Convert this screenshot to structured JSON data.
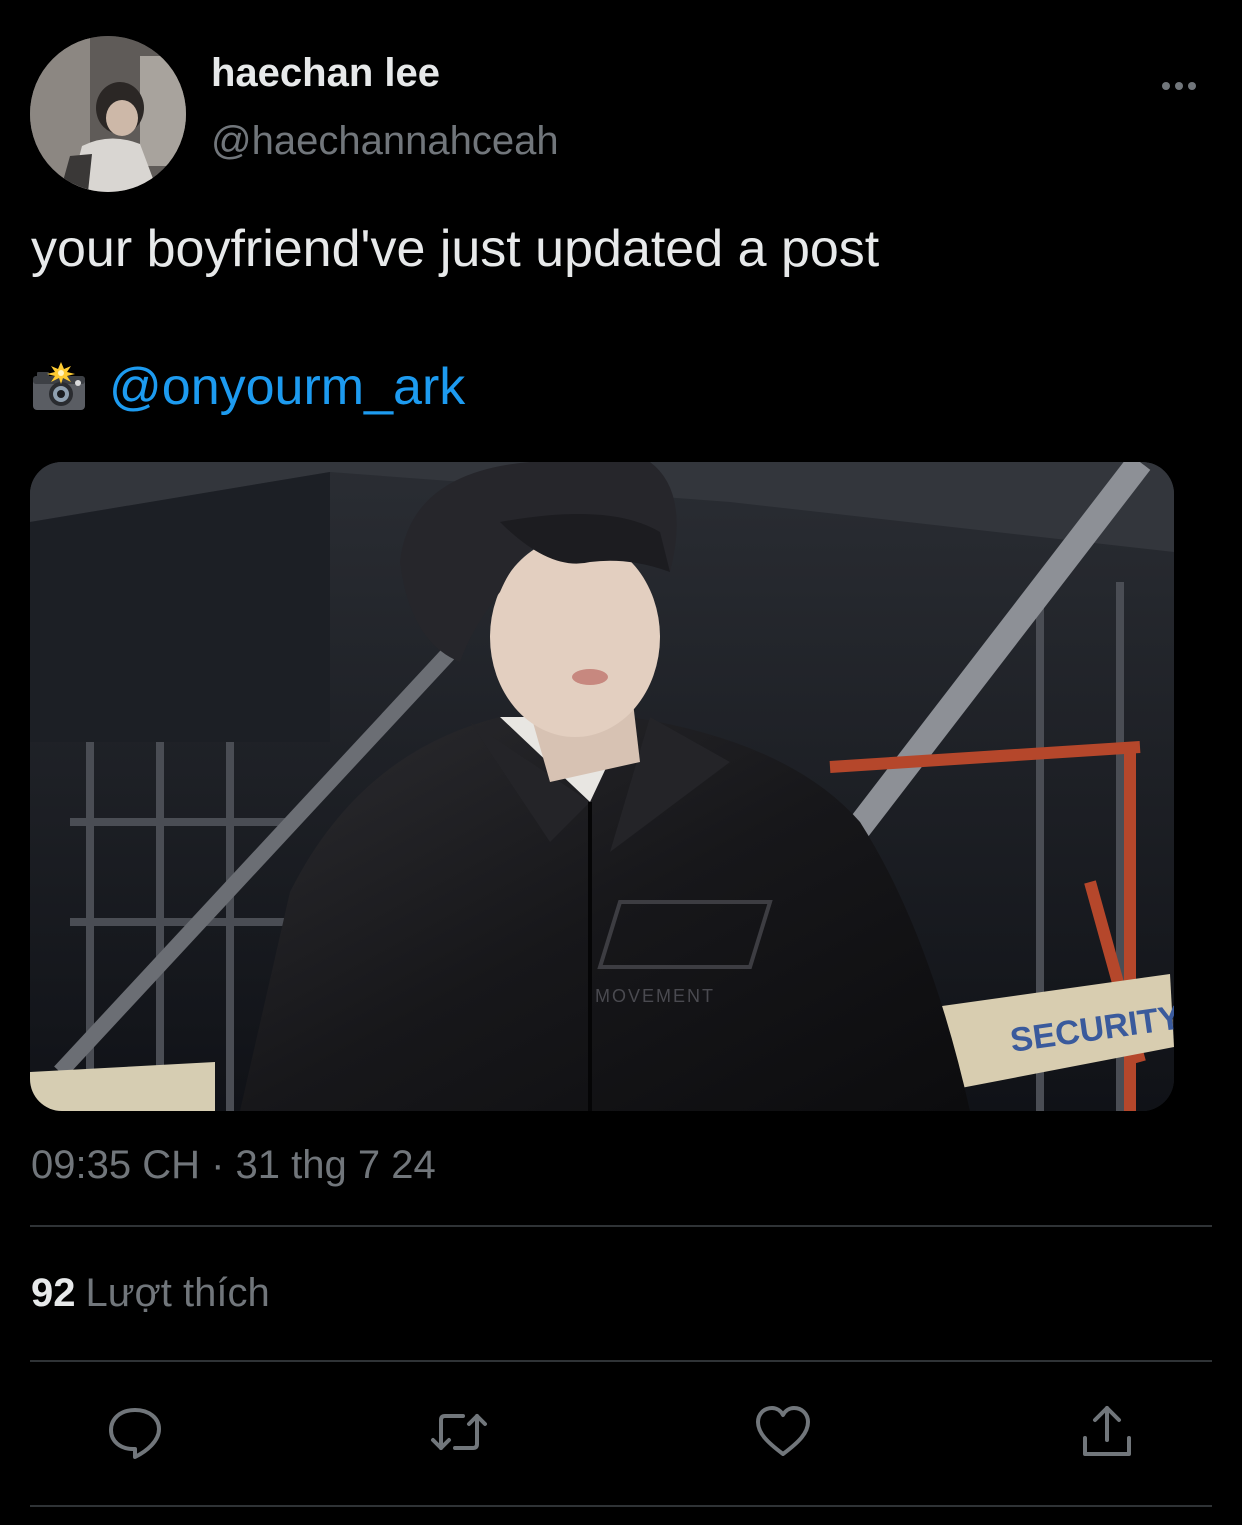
{
  "author": {
    "display_name": "haechan lee",
    "handle": "@haechannahceah"
  },
  "tweet": {
    "text": "your boyfriend've just updated a post",
    "credit_icon": "camera-flash-icon",
    "mention": "@onyourm_ark",
    "media_text": {
      "jacket_logo": "MOVEMENT",
      "sign": "SECURITY LINE"
    }
  },
  "meta": {
    "timestamp": "09:35 CH · 31 thg 7 24"
  },
  "stats": {
    "likes_count": "92",
    "likes_label": "Lượt thích"
  },
  "actions": [
    {
      "icon": "reply-icon"
    },
    {
      "icon": "retweet-icon"
    },
    {
      "icon": "like-icon"
    },
    {
      "icon": "share-icon"
    }
  ],
  "colors": {
    "background": "#000000",
    "primary_text": "#e7e9ea",
    "secondary_text": "#71767b",
    "link": "#1d9bf0",
    "divider": "#2f3336"
  }
}
